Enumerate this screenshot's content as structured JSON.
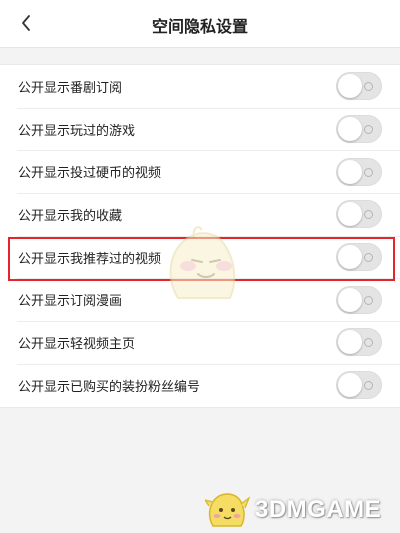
{
  "header": {
    "title": "空间隐私设置",
    "back_icon": "chevron-left-icon"
  },
  "settings": [
    {
      "label": "公开显示番剧订阅",
      "enabled": false
    },
    {
      "label": "公开显示玩过的游戏",
      "enabled": false
    },
    {
      "label": "公开显示投过硬币的视频",
      "enabled": false
    },
    {
      "label": "公开显示我的收藏",
      "enabled": false
    },
    {
      "label": "公开显示我推荐过的视频",
      "enabled": false,
      "highlighted": true
    },
    {
      "label": "公开显示订阅漫画",
      "enabled": false
    },
    {
      "label": "公开显示轻视频主页",
      "enabled": false
    },
    {
      "label": "公开显示已购买的装扮粉丝编号",
      "enabled": false
    }
  ],
  "watermark": {
    "text": "3DMGAME"
  },
  "colors": {
    "highlight": "#e5252a",
    "toggle_off": "#e4e4e4",
    "background": "#f3f3f3"
  }
}
